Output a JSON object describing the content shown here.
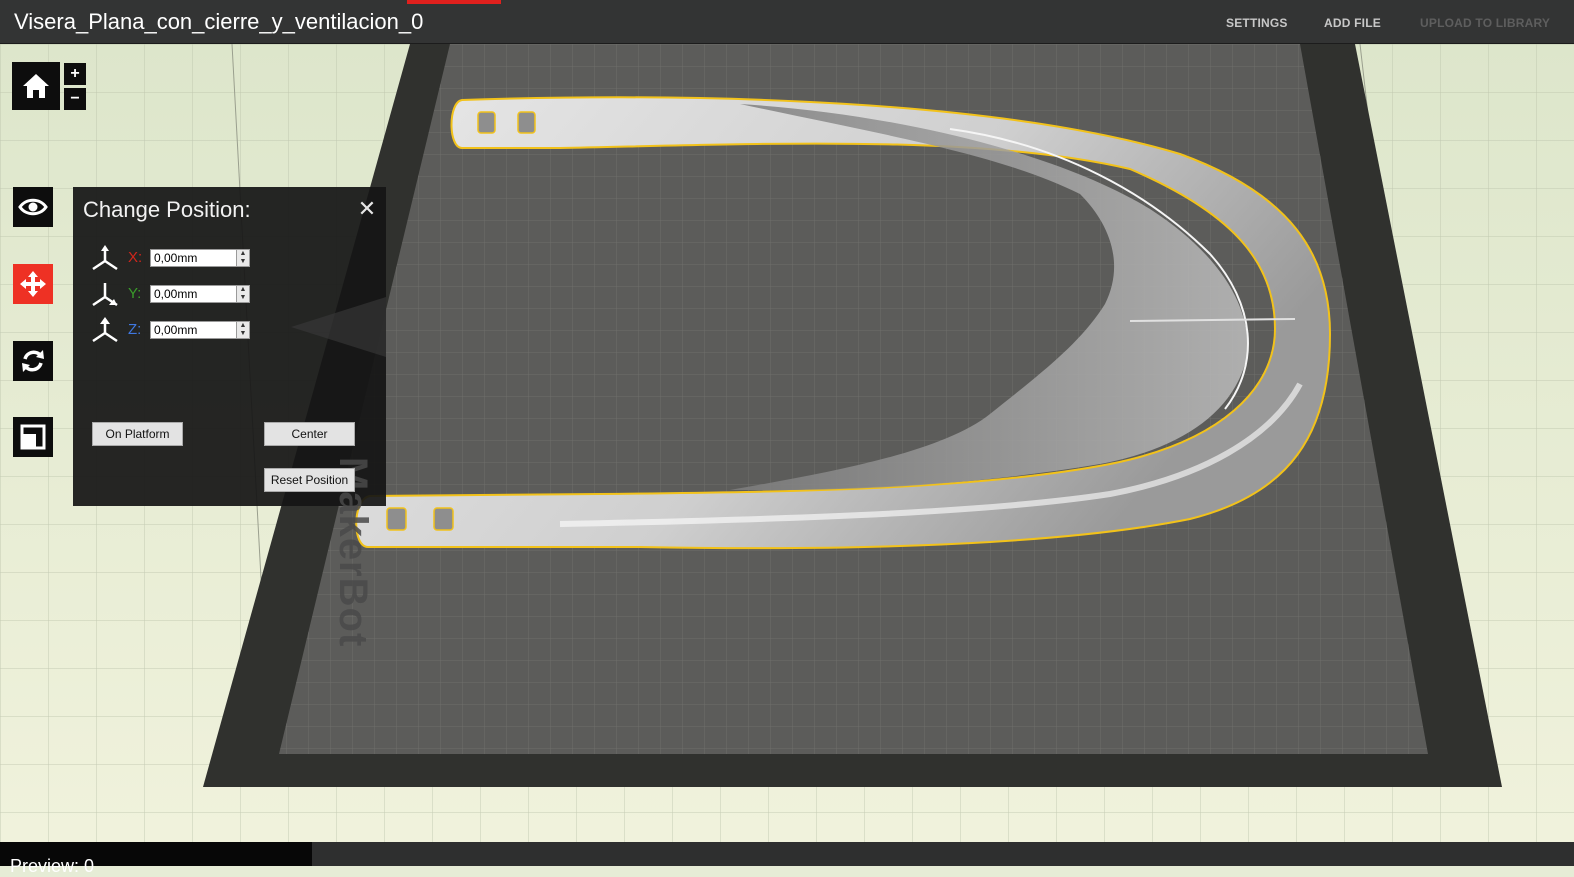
{
  "title_bar": {
    "document_name": "Visera_Plana_con_cierre_y_ventilacion_0",
    "menu": {
      "settings": "SETTINGS",
      "add_file": "ADD FILE",
      "upload": "UPLOAD TO LIBRARY"
    }
  },
  "toolbar": {
    "zoom_in": "+",
    "zoom_out": "−",
    "tools": [
      "home-icon",
      "eye-icon",
      "move-icon",
      "rotate-icon",
      "scale-icon"
    ],
    "active_tool": "move"
  },
  "position_panel": {
    "title": "Change Position:",
    "close": "✕",
    "axes": [
      {
        "label": "X:",
        "value": "0,00mm",
        "color": "#d0261c"
      },
      {
        "label": "Y:",
        "value": "0,00mm",
        "color": "#3a9c2a"
      },
      {
        "label": "Z:",
        "value": "0,00mm",
        "color": "#3f78e0"
      }
    ],
    "buttons": {
      "on_platform": "On Platform",
      "center": "Center",
      "reset": "Reset Position"
    },
    "watermark": "MakerBot"
  },
  "status_bar": {
    "text": "Preview: 0"
  },
  "colors": {
    "accent_red": "#e0201d",
    "selection_outline": "#f2c21a",
    "plate": "#5a5a58",
    "plate_border": "#2f302d",
    "background": "#e6ecd6"
  }
}
